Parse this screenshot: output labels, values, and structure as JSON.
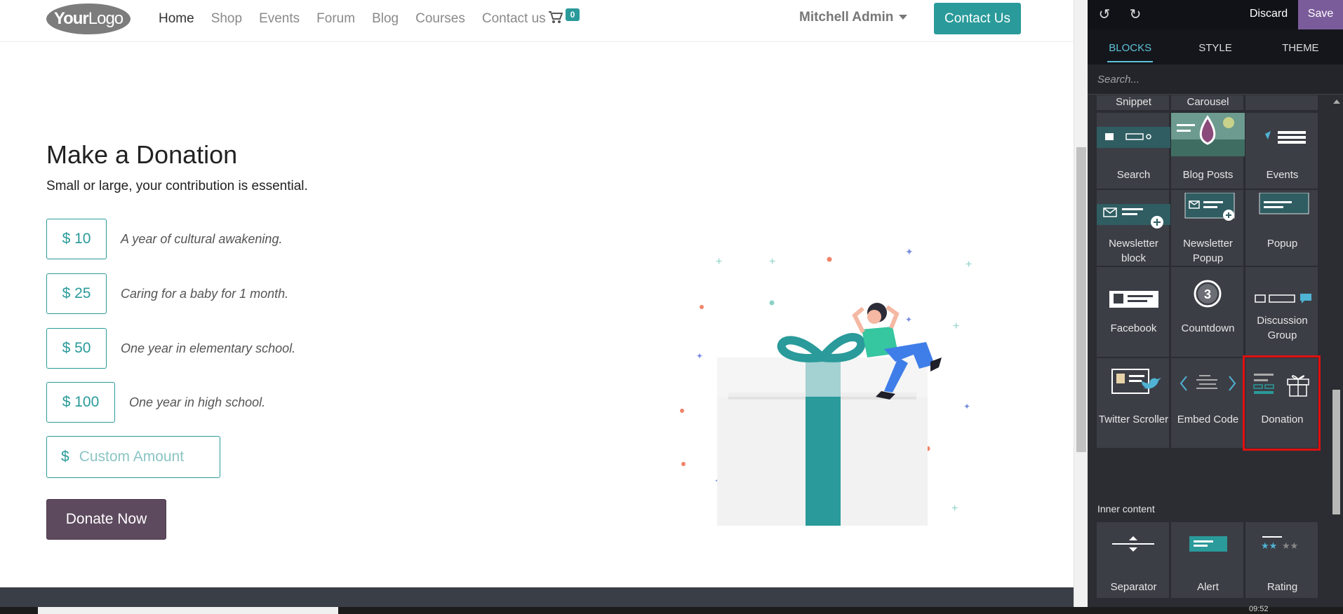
{
  "site": {
    "logo_main": "Your",
    "logo_light": "Logo",
    "menu": [
      "Home",
      "Shop",
      "Events",
      "Forum",
      "Blog",
      "Courses",
      "Contact us"
    ],
    "cart_count": "0",
    "user_name": "Mitchell Admin",
    "contact_button": "Contact Us"
  },
  "donation": {
    "title": "Make a Donation",
    "subtitle": "Small or large, your contribution is essential.",
    "amounts": [
      {
        "label": "$ 10",
        "desc": "A year of cultural awakening."
      },
      {
        "label": "$ 25",
        "desc": "Caring for a baby for 1 month."
      },
      {
        "label": "$ 50",
        "desc": "One year in elementary school."
      },
      {
        "label": "$ 100",
        "desc": "One year in high school."
      }
    ],
    "custom_currency": "$",
    "custom_placeholder": "Custom Amount",
    "donate_button": "Donate Now"
  },
  "editor": {
    "discard": "Discard",
    "save": "Save",
    "tabs": [
      "BLOCKS",
      "STYLE",
      "THEME"
    ],
    "search_placeholder": "Search...",
    "partial_labels": [
      "Snippet",
      "Carousel",
      ""
    ],
    "blocks": [
      "Search",
      "Blog Posts",
      "Events",
      "Newsletter block",
      "Newsletter Popup",
      "Popup",
      "Facebook",
      "Countdown",
      "Discussion Group",
      "Twitter Scroller",
      "Embed Code",
      "Donation"
    ],
    "selected_block": "Donation",
    "inner_content_title": "Inner content",
    "inner_blocks": [
      "Separator",
      "Alert",
      "Rating"
    ],
    "countdown_number": "3"
  },
  "taskbar": {
    "time": "09:52"
  },
  "colors": {
    "teal": "#2a9a9a",
    "save_purple": "#7b5c9b",
    "donate": "#5e4a5e",
    "panel": "#2b2d33",
    "highlight": "#e01010"
  }
}
